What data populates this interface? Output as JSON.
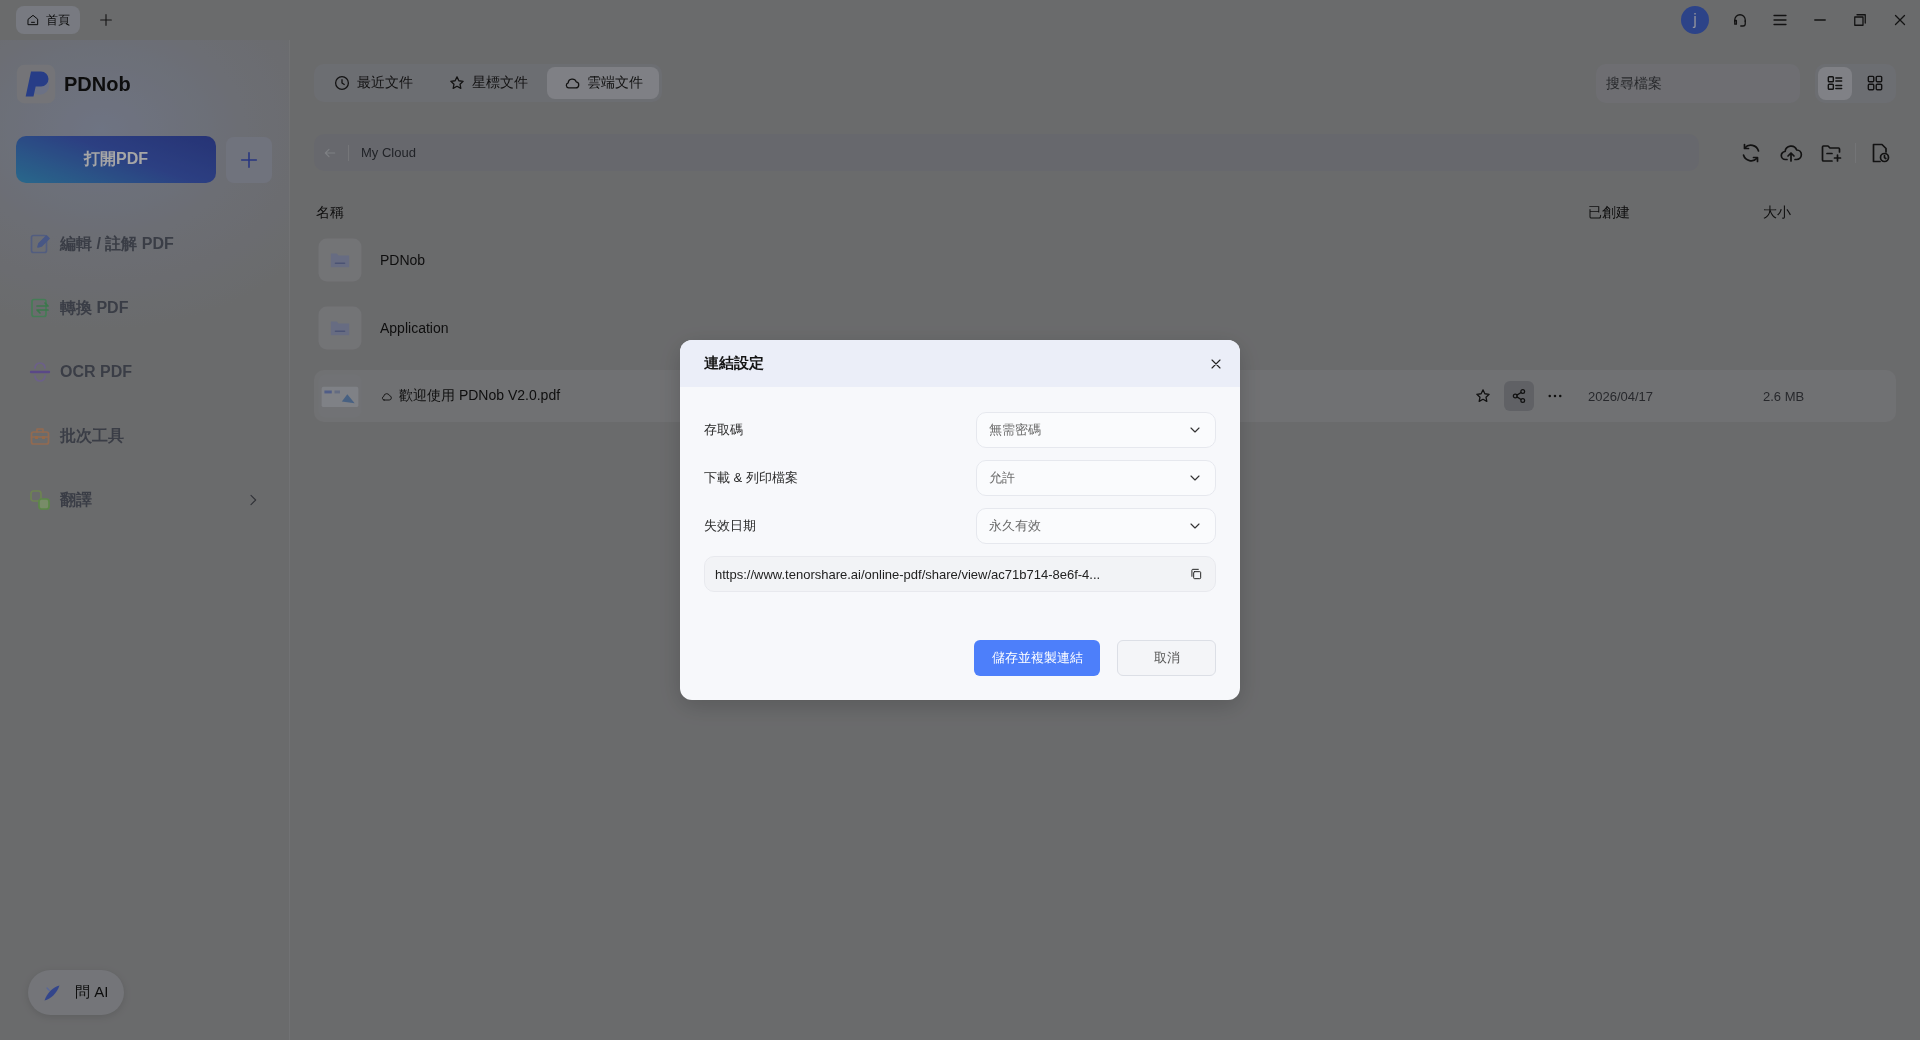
{
  "title_bar": {
    "tabs": [
      {
        "label": "首頁",
        "selected": true
      }
    ],
    "user_initial": "j"
  },
  "sidebar": {
    "app_name": "PDNob",
    "open_button": "打開PDF",
    "items": [
      {
        "kind": "edit",
        "label": "編輯 / 註解 PDF",
        "has_submenu": false
      },
      {
        "kind": "convert",
        "label": "轉換 PDF",
        "has_submenu": false
      },
      {
        "kind": "ocr",
        "label": "OCR PDF",
        "has_submenu": false
      },
      {
        "kind": "batch",
        "label": "批次工具",
        "has_submenu": false
      },
      {
        "kind": "translate",
        "label": "翻譯",
        "has_submenu": true
      }
    ],
    "ask_ai": "問 AI"
  },
  "tabs": [
    {
      "kind": "recent",
      "label": "最近文件",
      "selected": false
    },
    {
      "kind": "starred",
      "label": "星標文件",
      "selected": false
    },
    {
      "kind": "cloud",
      "label": "雲端文件",
      "selected": true
    }
  ],
  "search": {
    "placeholder": "搜尋檔案"
  },
  "view_modes": [
    {
      "kind": "list",
      "selected": true
    },
    {
      "kind": "grid",
      "selected": false
    }
  ],
  "breadcrumb": {
    "path": "My Cloud"
  },
  "table": {
    "columns": [
      "名稱",
      "已創建",
      "大小"
    ],
    "rows": [
      {
        "kind": "folder",
        "name": "PDNob",
        "cloud": false,
        "hovered": false
      },
      {
        "kind": "folder",
        "name": "Application",
        "cloud": false,
        "hovered": false
      },
      {
        "kind": "file",
        "name": "歡迎使用 PDNob V2.0.pdf",
        "cloud": true,
        "hovered": true,
        "actions": [
          {
            "kind": "star",
            "active": false
          },
          {
            "kind": "share",
            "active": true
          },
          {
            "kind": "more",
            "active": false
          }
        ],
        "created": "2026/04/17",
        "size": "2.6 MB"
      }
    ]
  },
  "dialog": {
    "title": "連結設定",
    "settings": [
      {
        "label": "存取碼",
        "value": "無需密碼"
      },
      {
        "label": "下載 & 列印檔案",
        "value": "允許"
      },
      {
        "label": "失效日期",
        "value": "永久有效"
      }
    ],
    "link": "https://www.tenorshare.ai/online-pdf/share/view/ac71b714-8e6f-4...",
    "buttons": [
      {
        "kind": "primary",
        "label": "儲存並複製連結"
      },
      {
        "kind": "secondary",
        "label": "取消"
      }
    ]
  }
}
